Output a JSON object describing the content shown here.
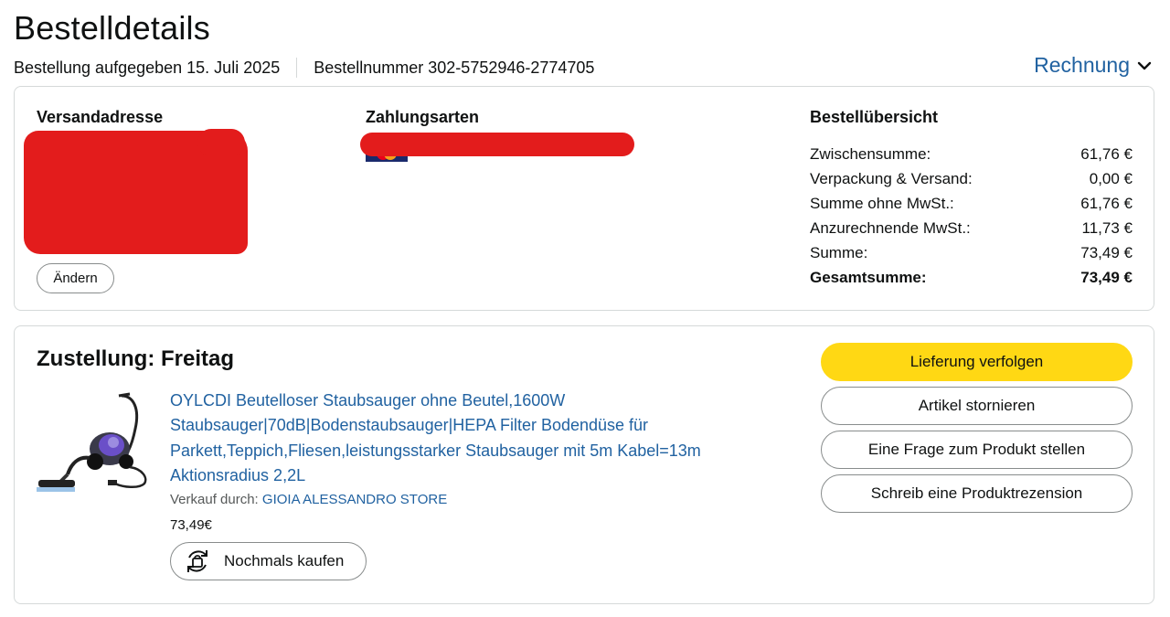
{
  "header": {
    "title": "Bestelldetails",
    "order_placed": "Bestellung aufgegeben 15. Juli 2025",
    "order_number": "Bestellnummer 302-5752946-2774705",
    "invoice_label": "Rechnung",
    "invoice_icon": "chevron-down-icon"
  },
  "shipping": {
    "title": "Versandadresse",
    "change_label": "Ändern"
  },
  "payment": {
    "title": "Zahlungsarten"
  },
  "summary": {
    "title": "Bestellübersicht",
    "rows": [
      {
        "label": "Zwischensumme:",
        "value": "61,76 €"
      },
      {
        "label": "Verpackung & Versand:",
        "value": "0,00 €"
      },
      {
        "label": "Summe ohne MwSt.:",
        "value": "61,76 €"
      },
      {
        "label": "Anzurechnende MwSt.:",
        "value": "11,73 €"
      },
      {
        "label": "Summe:",
        "value": "73,49 €"
      },
      {
        "label": "Gesamtsumme:",
        "value": "73,49 €"
      }
    ]
  },
  "delivery": {
    "title": "Zustellung: Freitag",
    "product": {
      "title": "OYLCDI Beutelloser Staubsauger ohne Beutel,1600W Staubsauger|70dB|Bodenstaubsauger|HEPA Filter Bodendüse für Parkett,Teppich,Fliesen,leistungsstarker Staubsauger mit 5m Kabel=13m Aktionsradius 2,2L",
      "seller_prefix": "Verkauf durch: ",
      "seller_name": "GIOIA ALESSANDRO STORE",
      "price": "73,49€",
      "rebuy_label": "Nochmals kaufen"
    },
    "actions": {
      "track": "Lieferung verfolgen",
      "cancel": "Artikel stornieren",
      "question": "Eine Frage zum Produkt stellen",
      "review": "Schreib eine Produktrezension"
    }
  },
  "colors": {
    "link": "#2162a1",
    "primary_button": "#ffd814",
    "redaction": "#e31c1c"
  }
}
